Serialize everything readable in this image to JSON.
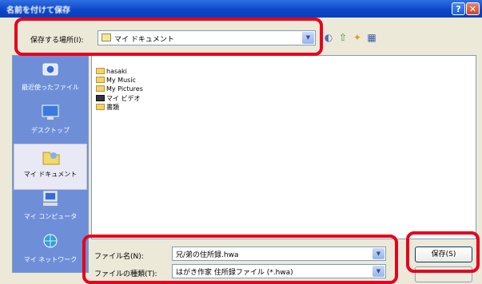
{
  "window": {
    "title": "名前を付けて保存",
    "help_glyph": "?",
    "close_glyph": "✕"
  },
  "location": {
    "label": "保存する場所(I):",
    "value": "マイ ドキュメント",
    "dropdown_glyph": "▼"
  },
  "toolbar": {
    "back_glyph": "◐",
    "up_glyph": "⇧",
    "newfolder_glyph": "✦",
    "views_glyph": "▦"
  },
  "places": [
    {
      "label": "最近使ったファイル",
      "icon": "recent-documents-icon",
      "selected": false
    },
    {
      "label": "デスクトップ",
      "icon": "desktop-icon",
      "selected": false
    },
    {
      "label": "マイ ドキュメント",
      "icon": "my-documents-icon",
      "selected": true
    },
    {
      "label": "マイ コンピュータ",
      "icon": "my-computer-icon",
      "selected": false
    },
    {
      "label": "マイ ネットワーク",
      "icon": "my-network-icon",
      "selected": false
    }
  ],
  "files": [
    {
      "name": "hasaki",
      "icon": "folder-icon"
    },
    {
      "name": "My Music",
      "icon": "folder-icon"
    },
    {
      "name": "My Pictures",
      "icon": "folder-icon"
    },
    {
      "name": "マイ ビデオ",
      "icon": "video-folder-icon"
    },
    {
      "name": "書類",
      "icon": "folder-icon"
    }
  ],
  "filename": {
    "label": "ファイル名(N):",
    "value": "兄/弟の住所録.hwa"
  },
  "filetype": {
    "label": "ファイルの種類(T):",
    "value": "はがき作家 住所録ファイル (*.hwa)"
  },
  "buttons": {
    "save": "保存(S)"
  },
  "colors": {
    "highlight": "#e6001e",
    "titlebar": "#0a44c8",
    "places_bg": "#6e8fd8"
  }
}
